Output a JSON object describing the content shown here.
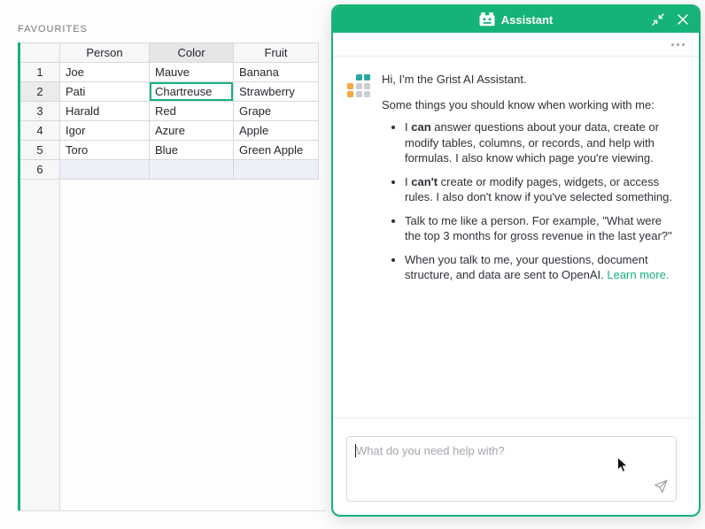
{
  "colors": {
    "accent": "#16b378",
    "link": "#16b378",
    "logo_teal": "#2ba7a2",
    "logo_orange": "#f5a742",
    "logo_gray": "#cdced2",
    "new_row_bg": "#eef0f9"
  },
  "favourites": {
    "label": "FAVOURITES",
    "columns": [
      "Person",
      "Color",
      "Fruit"
    ],
    "rows": [
      {
        "num": "1",
        "cells": [
          "Joe",
          "Mauve",
          "Banana"
        ]
      },
      {
        "num": "2",
        "cells": [
          "Pati",
          "Chartreuse",
          "Strawberry"
        ]
      },
      {
        "num": "3",
        "cells": [
          "Harald",
          "Red",
          "Grape"
        ]
      },
      {
        "num": "4",
        "cells": [
          "Igor",
          "Azure",
          "Apple"
        ]
      },
      {
        "num": "5",
        "cells": [
          "Toro",
          "Blue",
          "Green Apple"
        ]
      },
      {
        "num": "6",
        "cells": [
          "",
          "",
          ""
        ]
      }
    ],
    "selection": {
      "row": "2",
      "column": "Color",
      "cell_value": "Chartreuse"
    }
  },
  "assistant": {
    "title": "Assistant",
    "greeting": "Hi, I'm the Grist AI Assistant.",
    "intro": "Some things you should know when working with me:",
    "bullets": {
      "b1": {
        "pre": "I ",
        "bold": "can",
        "rest": " answer questions about your data, create or modify tables, columns, or records, and help with formulas. I also know which page you're viewing."
      },
      "b2": {
        "pre": "I ",
        "bold": "can't",
        "rest": " create or modify pages, widgets, or access rules. I also don't know if you've selected something."
      },
      "b3": {
        "text": "Talk to me like a person. For example, \"What were the top 3 months for gross revenue in the last year?\""
      },
      "b4": {
        "text": "When you talk to me, your questions, document structure, and data are sent to OpenAI. ",
        "link": "Learn more."
      }
    },
    "input": {
      "placeholder": "What do you need help with?"
    }
  }
}
